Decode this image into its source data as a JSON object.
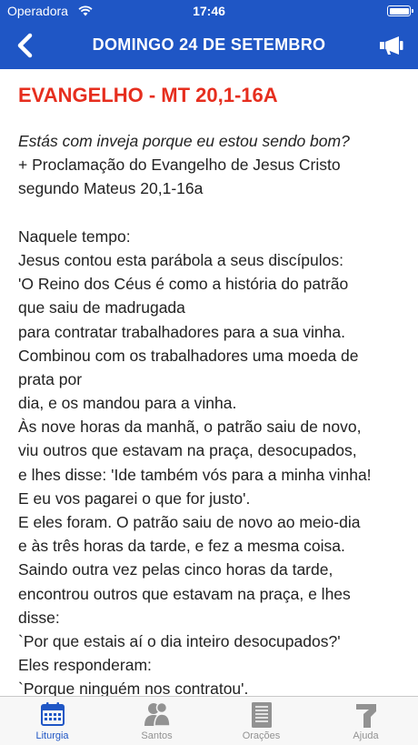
{
  "status_bar": {
    "carrier": "Operadora",
    "time": "17:46"
  },
  "nav": {
    "title": "DOMINGO 24 DE SETEMBRO"
  },
  "reading": {
    "title": "EVANGELHO - MT 20,1-16A",
    "lines": [
      {
        "text": "Estás com inveja porque eu estou sendo bom?",
        "style": "italic"
      },
      {
        "text": "+ Proclamação do Evangelho de Jesus Cristo"
      },
      {
        "text": "segundo Mateus 20,1-16a"
      },
      {
        "text": "",
        "style": "gap"
      },
      {
        "text": "Naquele tempo:"
      },
      {
        "text": "Jesus contou esta parábola a seus discípulos:"
      },
      {
        "text": "'O Reino dos Céus é como a história do patrão"
      },
      {
        "text": "que saiu de madrugada"
      },
      {
        "text": "para contratar trabalhadores para a sua vinha."
      },
      {
        "text": "Combinou com os trabalhadores uma moeda de"
      },
      {
        "text": "prata por"
      },
      {
        "text": "dia, e os mandou para a vinha."
      },
      {
        "text": "Às nove horas da manhã, o patrão saiu de novo,"
      },
      {
        "text": "viu outros que estavam na praça, desocupados,"
      },
      {
        "text": "e lhes disse: 'Ide também vós para a minha vinha!"
      },
      {
        "text": "E eu vos pagarei o que for justo'."
      },
      {
        "text": "E eles foram. O patrão saiu de novo ao meio-dia"
      },
      {
        "text": "e às três horas da tarde, e fez a mesma coisa."
      },
      {
        "text": "Saindo outra vez pelas cinco horas da tarde,"
      },
      {
        "text": "encontrou outros que estavam na praça, e lhes"
      },
      {
        "text": "disse:"
      },
      {
        "text": "`Por que estais aí o dia inteiro desocupados?'"
      },
      {
        "text": "Eles responderam:"
      },
      {
        "text": "`Porque ninguém nos contratou'."
      }
    ]
  },
  "tabs": [
    {
      "label": "Liturgia",
      "icon": "calendar-icon",
      "active": true
    },
    {
      "label": "Santos",
      "icon": "people-icon",
      "active": false
    },
    {
      "label": "Orações",
      "icon": "book-icon",
      "active": false
    },
    {
      "label": "Ajuda",
      "icon": "help-icon",
      "active": false
    }
  ],
  "colors": {
    "brand": "#1f56c5",
    "title_red": "#e62e1e",
    "tab_inactive": "#929292"
  }
}
